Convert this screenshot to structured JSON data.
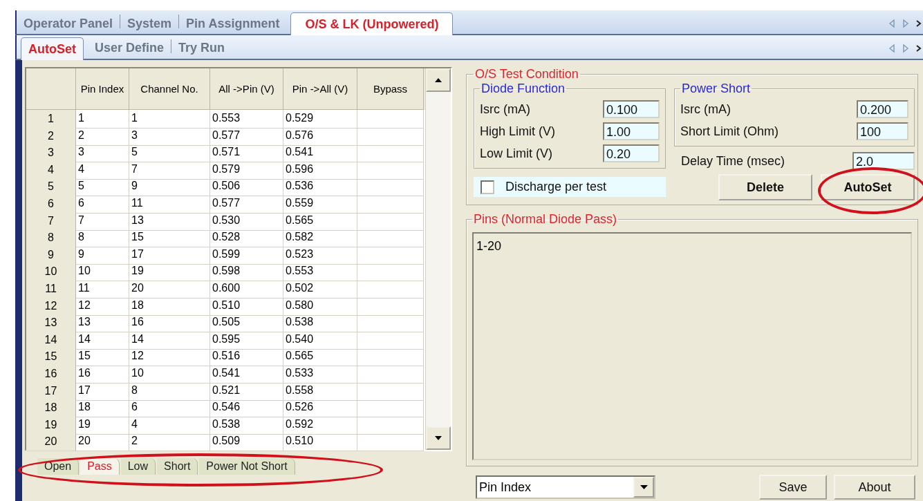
{
  "main_tabs": [
    {
      "label": "Operator Panel",
      "selected": false
    },
    {
      "label": "System",
      "selected": false
    },
    {
      "label": "Pin Assignment",
      "selected": false
    },
    {
      "label": "O/S & LK (Unpowered)",
      "selected": true
    }
  ],
  "sub_tabs": [
    {
      "label": "AutoSet",
      "selected": true
    },
    {
      "label": "User Define",
      "selected": false
    },
    {
      "label": "Try Run",
      "selected": false
    }
  ],
  "table": {
    "columns": [
      "",
      "Pin Index",
      "Channel No.",
      "All ->Pin (V)",
      "Pin ->All (V)",
      "Bypass"
    ],
    "rows": [
      [
        "1",
        "1",
        "1",
        "0.553",
        "0.529",
        ""
      ],
      [
        "2",
        "2",
        "3",
        "0.577",
        "0.576",
        ""
      ],
      [
        "3",
        "3",
        "5",
        "0.571",
        "0.541",
        ""
      ],
      [
        "4",
        "4",
        "7",
        "0.579",
        "0.596",
        ""
      ],
      [
        "5",
        "5",
        "9",
        "0.506",
        "0.536",
        ""
      ],
      [
        "6",
        "6",
        "11",
        "0.577",
        "0.559",
        ""
      ],
      [
        "7",
        "7",
        "13",
        "0.530",
        "0.565",
        ""
      ],
      [
        "8",
        "8",
        "15",
        "0.528",
        "0.582",
        ""
      ],
      [
        "9",
        "9",
        "17",
        "0.599",
        "0.523",
        ""
      ],
      [
        "10",
        "10",
        "19",
        "0.598",
        "0.553",
        ""
      ],
      [
        "11",
        "11",
        "20",
        "0.600",
        "0.502",
        ""
      ],
      [
        "12",
        "12",
        "18",
        "0.510",
        "0.580",
        ""
      ],
      [
        "13",
        "13",
        "16",
        "0.505",
        "0.538",
        ""
      ],
      [
        "14",
        "14",
        "14",
        "0.595",
        "0.540",
        ""
      ],
      [
        "15",
        "15",
        "12",
        "0.516",
        "0.565",
        ""
      ],
      [
        "16",
        "16",
        "10",
        "0.541",
        "0.533",
        ""
      ],
      [
        "17",
        "17",
        "8",
        "0.521",
        "0.558",
        ""
      ],
      [
        "18",
        "18",
        "6",
        "0.546",
        "0.526",
        ""
      ],
      [
        "19",
        "19",
        "4",
        "0.538",
        "0.592",
        ""
      ],
      [
        "20",
        "20",
        "2",
        "0.509",
        "0.510",
        ""
      ]
    ]
  },
  "result_tabs": {
    "circled": true,
    "tabs": [
      {
        "label": "Open",
        "selected": false
      },
      {
        "label": "Pass",
        "selected": true
      },
      {
        "label": "Low",
        "selected": false
      },
      {
        "label": "Short",
        "selected": false
      },
      {
        "label": "Power Not Short",
        "selected": false
      }
    ]
  },
  "test_condition": {
    "title": "O/S Test Condition",
    "diode_function": {
      "title": "Diode Function",
      "fields": [
        {
          "label": "Isrc (mA)",
          "value": "0.100"
        },
        {
          "label": "High Limit (V)",
          "value": "1.00"
        },
        {
          "label": "Low Limit (V)",
          "value": "0.20"
        }
      ]
    },
    "power_short": {
      "title": "Power Short",
      "fields": [
        {
          "label": "Isrc (mA)",
          "value": "0.200"
        },
        {
          "label": "Short Limit (Ohm)",
          "value": "100"
        }
      ]
    },
    "delay_time": {
      "label": "Delay Time (msec)",
      "value": "2.0"
    },
    "discharge": {
      "label": "Discharge per test",
      "checked": false
    },
    "buttons": [
      {
        "label": "Delete",
        "circled": false
      },
      {
        "label": "AutoSet",
        "circled": true
      }
    ]
  },
  "pins": {
    "title": "Pins (Normal Diode Pass)",
    "text": "1-20"
  },
  "sort_select": {
    "value": "Pin Index"
  },
  "bottom_buttons": [
    "Save",
    "About"
  ]
}
